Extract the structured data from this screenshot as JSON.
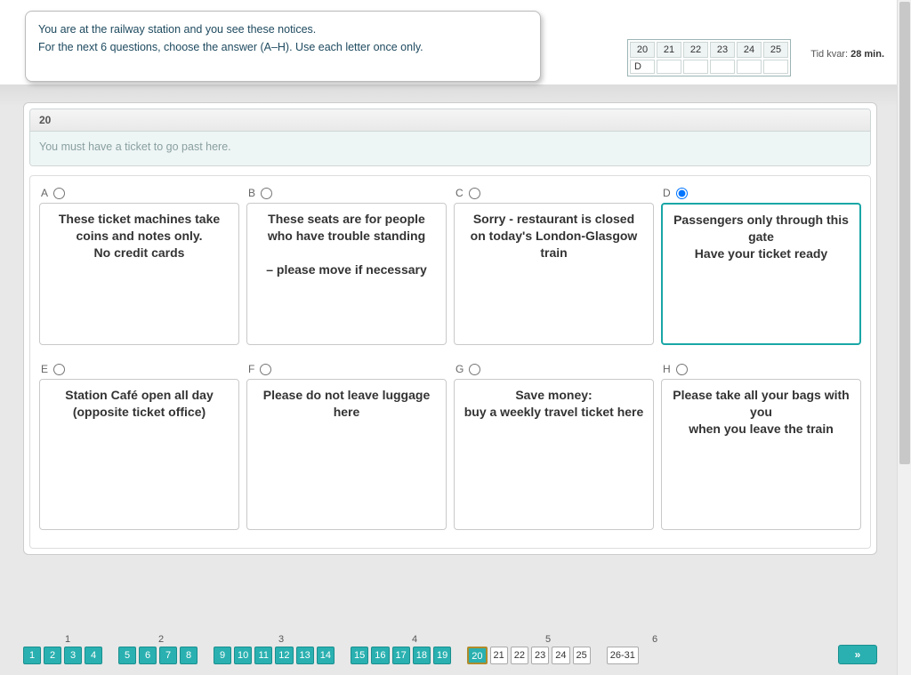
{
  "instructions": {
    "line1": "You are at the railway station and you see these notices.",
    "line2": "For the next 6 questions, choose the answer (A–H). Use each letter once only."
  },
  "status": {
    "questions": [
      "20",
      "21",
      "22",
      "23",
      "24",
      "25"
    ],
    "answers": [
      "D",
      "",
      "",
      "",
      "",
      ""
    ]
  },
  "timer": {
    "label": "Tid kvar:",
    "value": "28 min."
  },
  "question": {
    "number": "20",
    "text": "You must have a ticket to go past here."
  },
  "options": [
    {
      "letter": "A",
      "text": "These ticket machines take coins and notes only.\nNo credit cards",
      "selected": false
    },
    {
      "letter": "B",
      "text": "These seats are for people who have trouble standing\n\n– please move if necessary",
      "selected": false
    },
    {
      "letter": "C",
      "text": "Sorry - restaurant is closed\non today's London-Glasgow train",
      "selected": false
    },
    {
      "letter": "D",
      "text": "Passengers only through this gate\nHave your ticket ready",
      "selected": true
    },
    {
      "letter": "E",
      "text": "Station Café open all day\n(opposite ticket office)",
      "selected": false
    },
    {
      "letter": "F",
      "text": "Please do not leave luggage here",
      "selected": false
    },
    {
      "letter": "G",
      "text": "Save money:\nbuy a weekly travel ticket here",
      "selected": false
    },
    {
      "letter": "H",
      "text": "Please take all your bags with you\nwhen you leave the train",
      "selected": false
    }
  ],
  "nav": {
    "group_labels": [
      "1",
      "2",
      "3",
      "4",
      "5",
      "6"
    ],
    "groups": [
      {
        "range": "26-31",
        "items": [
          "1",
          "2",
          "3",
          "4"
        ],
        "done": true
      },
      {
        "items": [
          "5",
          "6",
          "7",
          "8"
        ],
        "done": true
      },
      {
        "items": [
          "9",
          "10",
          "11",
          "12",
          "13",
          "14"
        ],
        "done": true
      },
      {
        "items": [
          "15",
          "16",
          "17",
          "18",
          "19"
        ],
        "done": true
      },
      {
        "items": [
          "20",
          "21",
          "22",
          "23",
          "24",
          "25"
        ],
        "done": false,
        "current": "20"
      },
      {
        "items": [
          "26-31"
        ],
        "done": false
      }
    ],
    "next_icon": "»"
  }
}
